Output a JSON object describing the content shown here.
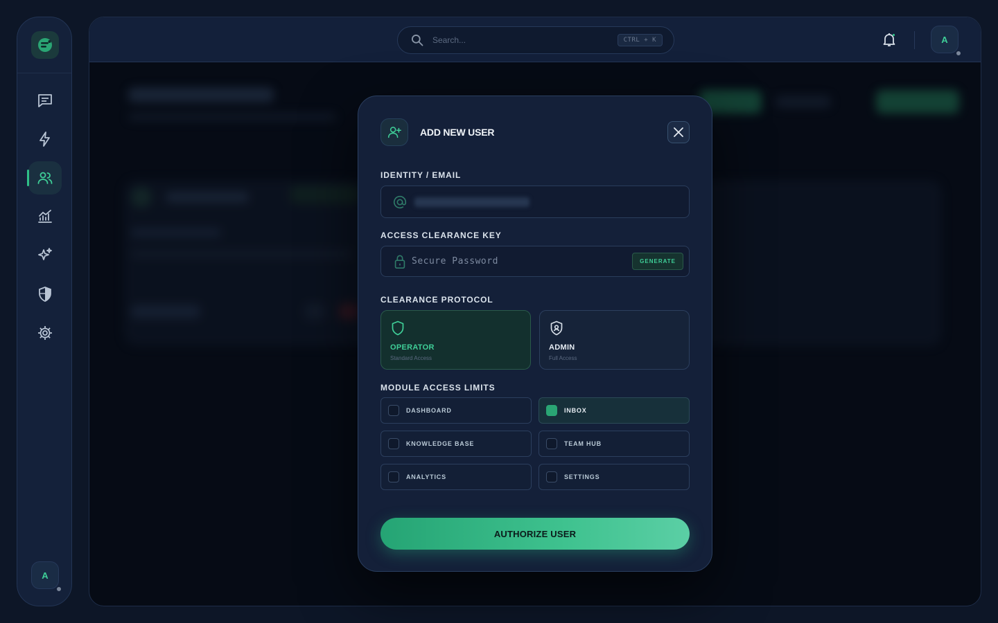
{
  "sidebar": {
    "logo_icon": "logo-icon",
    "items": [
      {
        "name": "messages",
        "icon": "chat-icon"
      },
      {
        "name": "automation",
        "icon": "bolt-icon"
      },
      {
        "name": "users",
        "icon": "users-icon",
        "active": true
      },
      {
        "name": "analytics",
        "icon": "chart-icon"
      },
      {
        "name": "ai",
        "icon": "sparkles-icon"
      },
      {
        "name": "security",
        "icon": "shield-icon"
      },
      {
        "name": "settings",
        "icon": "gear-icon"
      }
    ],
    "avatar_initial": "A"
  },
  "topbar": {
    "search_placeholder": "Search...",
    "shortcut": "CTRL + K",
    "avatar_initial": "A"
  },
  "modal": {
    "title": "ADD NEW USER",
    "identity_label": "IDENTITY / EMAIL",
    "key_label": "ACCESS CLEARANCE KEY",
    "password_placeholder": "Secure Password",
    "generate_label": "GENERATE",
    "protocol_label": "CLEARANCE PROTOCOL",
    "roles": [
      {
        "name": "OPERATOR",
        "desc": "Standard Access",
        "selected": true
      },
      {
        "name": "ADMIN",
        "desc": "Full Access",
        "selected": false
      }
    ],
    "modules_label": "MODULE ACCESS LIMITS",
    "modules": [
      {
        "name": "DASHBOARD",
        "checked": false
      },
      {
        "name": "INBOX",
        "checked": true
      },
      {
        "name": "KNOWLEDGE BASE",
        "checked": false
      },
      {
        "name": "TEAM HUB",
        "checked": false
      },
      {
        "name": "ANALYTICS",
        "checked": false
      },
      {
        "name": "SETTINGS",
        "checked": false
      }
    ],
    "submit_label": "AUTHORIZE USER"
  },
  "colors": {
    "accent": "#2fbf88",
    "background": "#0d1627",
    "panel": "#142039"
  }
}
